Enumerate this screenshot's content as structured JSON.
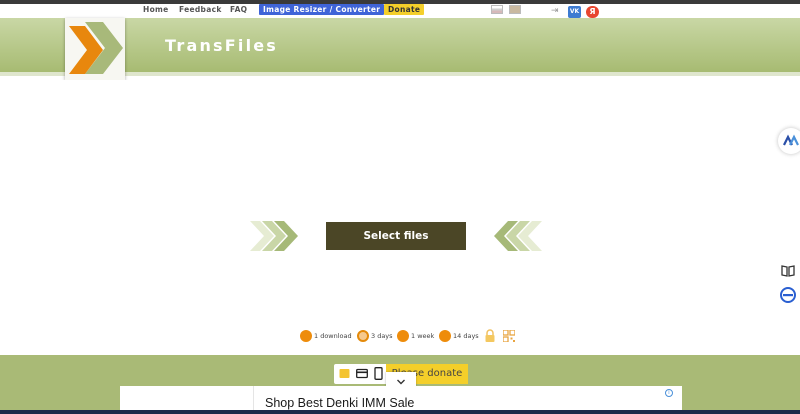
{
  "nav": {
    "home": "Home",
    "feedback": "Feedback",
    "faq": "FAQ",
    "image_resizer": "Image Resizer / Converter",
    "donate": "Donate",
    "vk": "VK",
    "ya": "Я"
  },
  "header": {
    "title": "TransFiles"
  },
  "main": {
    "select_files": "Select files"
  },
  "options": {
    "items": [
      {
        "label": "1 download",
        "selected": false
      },
      {
        "label": "3 days",
        "selected": true
      },
      {
        "label": "1 week",
        "selected": false
      },
      {
        "label": "14 days",
        "selected": false
      }
    ],
    "lock_icon": "lock-icon",
    "qr_icon": "qr-code-icon"
  },
  "footer": {
    "donate": "Please donate"
  },
  "ad": {
    "text": "Shop Best Denki IMM Sale",
    "info": "i"
  },
  "colors": {
    "header_green": "#a7bb72",
    "button_dark": "#4b4626",
    "accent_orange": "#ee8c0b",
    "donate_yellow": "#f4cf2a",
    "resizer_blue": "#3f64d8"
  }
}
